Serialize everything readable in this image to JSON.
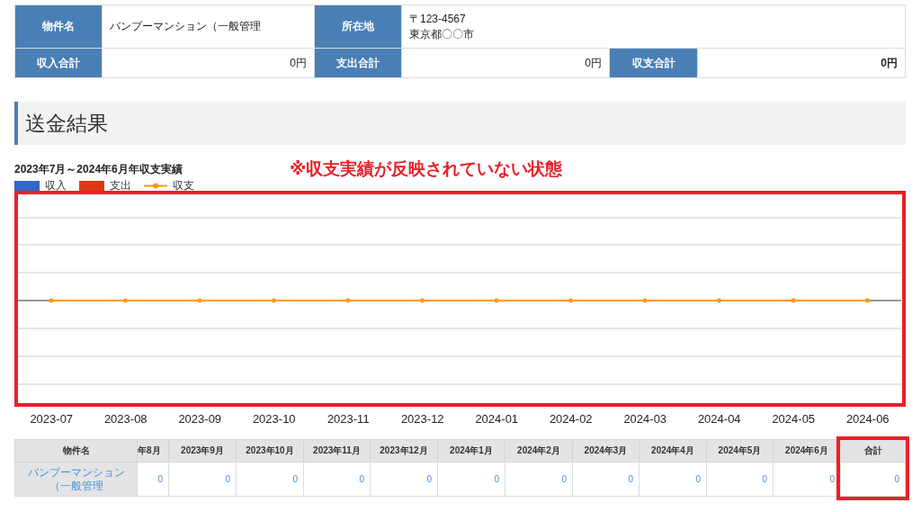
{
  "property_info": {
    "rows": [
      [
        {
          "label": "物件名",
          "value": "バンブーマンション（一般管理"
        },
        {
          "label": "所在地",
          "value_lines": [
            "〒123-4567",
            "東京都〇〇市"
          ]
        }
      ],
      [
        {
          "label": "収入合計",
          "value": "0円"
        },
        {
          "label": "支出合計",
          "value": "0円"
        },
        {
          "label": "収支合計",
          "value": "0円",
          "bold": true
        }
      ]
    ]
  },
  "section_heading": "送金結果",
  "chart": {
    "note": "※収支実績が反映されていない状態",
    "legend": [
      {
        "label": "収入",
        "kind": "swatch",
        "color": "#3366cc"
      },
      {
        "label": "支出",
        "kind": "swatch",
        "color": "#dc3912"
      },
      {
        "label": "収支",
        "kind": "line",
        "color": "#ff9900"
      }
    ],
    "title": "2023年7月～2024年6月年収支実績",
    "x_labels": [
      "2023-07",
      "2023-08",
      "2023-09",
      "2023-10",
      "2023-11",
      "2023-12",
      "2024-01",
      "2024-02",
      "2024-03",
      "2024-04",
      "2024-05",
      "2024-06"
    ]
  },
  "monthly_table": {
    "columns": [
      "物件名",
      "年8月",
      "2023年9月",
      "2023年10月",
      "2023年11月",
      "2023年12月",
      "2024年1月",
      "2024年2月",
      "2024年3月",
      "2024年4月",
      "2024年5月",
      "2024年6月",
      "合計"
    ],
    "rows": [
      {
        "name": "バンブーマンション（一般管理",
        "values": [
          "0",
          "0",
          "0",
          "0",
          "0",
          "0",
          "0",
          "0",
          "0",
          "0",
          "0",
          "0"
        ]
      }
    ]
  }
}
